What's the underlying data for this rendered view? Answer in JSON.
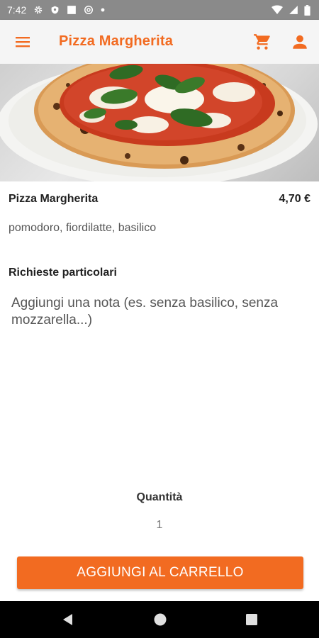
{
  "status_bar": {
    "time": "7:42",
    "icons": [
      "gear-icon",
      "shield-icon",
      "square-icon",
      "at-sign-icon",
      "dot-icon",
      "wifi-icon",
      "signal-icon",
      "battery-icon"
    ]
  },
  "app_bar": {
    "title": "Pizza Margherita",
    "menu_icon": "menu-icon",
    "cart_icon": "cart-icon",
    "account_icon": "account-icon"
  },
  "colors": {
    "accent": "#f26b21",
    "status_bar": "#8a8a8a",
    "app_bar": "#f5f5f5",
    "nav_bar": "#000000"
  },
  "product": {
    "image": "pizza-margherita-photo",
    "name": "Pizza Margherita",
    "price": "4,70 €",
    "ingredients": "pomodoro, fiordilatte, basilico"
  },
  "notes": {
    "label": "Richieste particolari",
    "placeholder": "Aggiungi una nota (es. senza basilico, senza mozzarella...)",
    "value": ""
  },
  "quantity": {
    "label": "Quantità",
    "value": "1"
  },
  "add_button": {
    "label": "AGGIUNGI AL CARRELLO"
  },
  "nav_bar": {
    "icons": [
      "back-icon",
      "home-icon",
      "recents-icon"
    ]
  }
}
